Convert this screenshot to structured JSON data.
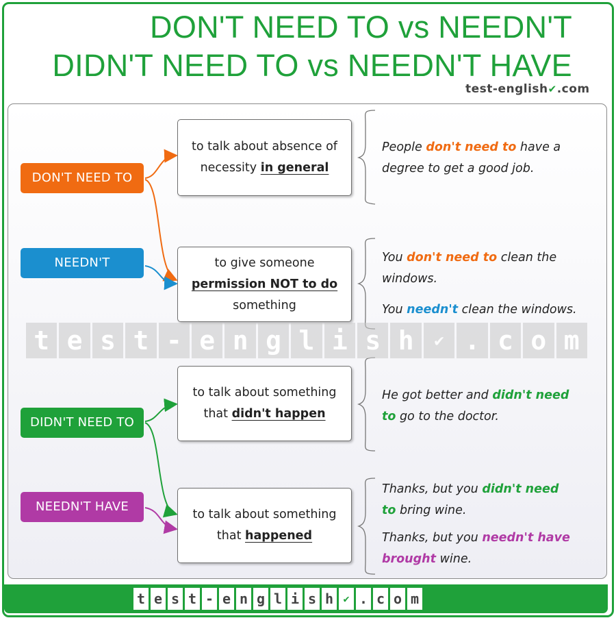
{
  "title": {
    "line1": "DON'T NEED TO vs NEEDN'T",
    "line2": "DIDN'T NEED TO vs NEEDN'T HAVE"
  },
  "logo": {
    "text": "test-english",
    "suffix": ".com",
    "check": "✔"
  },
  "watermark": [
    "t",
    "e",
    "s",
    "t",
    "-",
    "e",
    "n",
    "g",
    "l",
    "i",
    "s",
    "h",
    "✔",
    ".",
    "c",
    "o",
    "m"
  ],
  "colors": {
    "green": "#1fa13a",
    "orange": "#f06b12",
    "blue": "#1b8fcf",
    "purple": "#b03aa5"
  },
  "tags": {
    "dont_need_to": "DON'T NEED TO",
    "neednt": "NEEDN'T",
    "didnt_need_to": "DIDN'T NEED TO",
    "neednt_have": "NEEDN'T HAVE"
  },
  "boxes": {
    "box1": {
      "line1": "to talk about absence of",
      "pre": "necessity ",
      "bold": "in general"
    },
    "box2": {
      "line1": "to give someone",
      "bold": "permission NOT to do",
      "line3": "something"
    },
    "box3": {
      "line1": "to talk about something",
      "pre": "that ",
      "bold": "didn't happen"
    },
    "box4": {
      "line1": "to talk about something",
      "pre": "that ",
      "bold": "happened"
    }
  },
  "examples": {
    "ex1": {
      "a": "People ",
      "hl": "don't need to",
      "b": " have a",
      "c": "degree to get a good job."
    },
    "ex2": {
      "a": "You ",
      "hl": "don't need to",
      "b": " clean the",
      "c": "windows."
    },
    "ex3": {
      "a": "You ",
      "hl": "needn't",
      "b": " clean the windows."
    },
    "ex4": {
      "a": "He got better and ",
      "hl": "didn't need",
      "hl2": "to",
      "b": "  go to the doctor."
    },
    "ex5": {
      "a": "Thanks, but you ",
      "hl": "didn't need",
      "hl2": "to",
      "b": " bring wine."
    },
    "ex6": {
      "a": "Thanks, but you ",
      "hl": "needn't have",
      "hl2": "brought",
      "b": " wine."
    }
  }
}
